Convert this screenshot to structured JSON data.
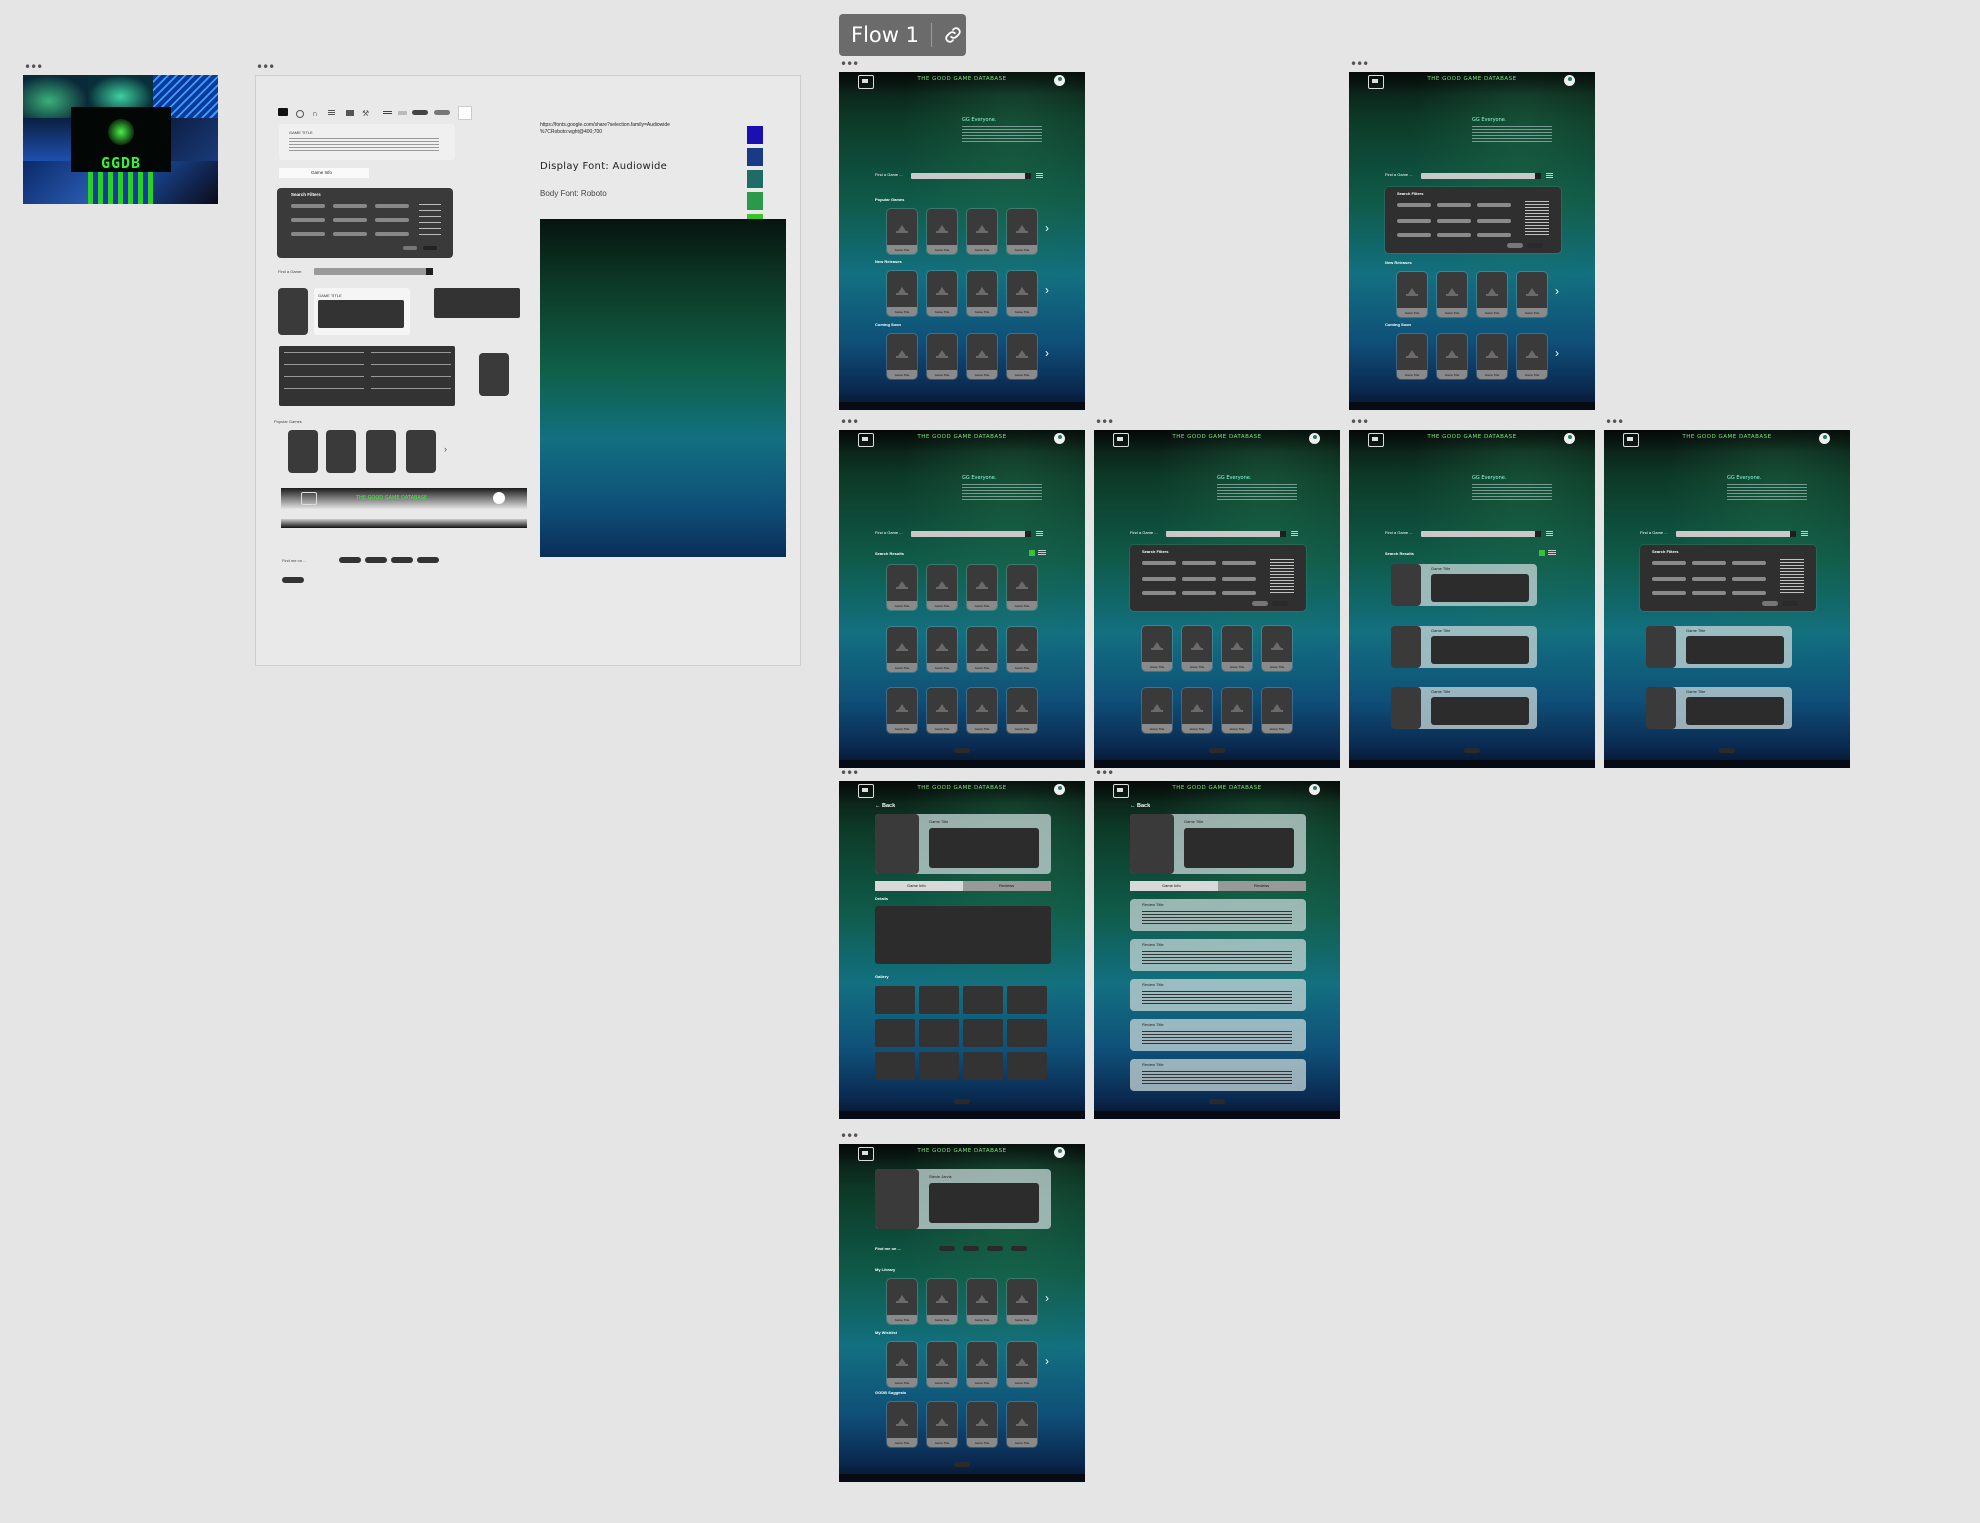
{
  "flow": {
    "label": "Flow 1"
  },
  "moodboard": {
    "logo_text": "GGDB"
  },
  "style_guide": {
    "url_line1": "https://fonts.google.com/share?selection.family=Audiowide",
    "url_line2": "%7CRoboto:wght@400;700",
    "display_font": "Display Font: Audiowide",
    "body_font": "Body Font: Roboto",
    "colors": [
      "#1a0fb0",
      "#1b3a86",
      "#1f6b66",
      "#2a9a4a",
      "#34c52e",
      "#47f21c"
    ],
    "game_info_label": "Game Info",
    "search_filters_label": "Search Filters",
    "find_a_game_label": "Find a Game:",
    "popular_games_label": "Popular Games",
    "game_title": "Game Title",
    "brand": "THE GOOD GAME DATABASE",
    "find_me_label": "Find me on ..."
  },
  "screen": {
    "brand": "THE GOOD GAME DATABASE",
    "welcome": "GG Everyone.",
    "find_label": "Find a Game ...",
    "popular": "Popular Games",
    "new_releases": "New Releases",
    "coming_soon": "Coming Soon",
    "search_results": "Search Results",
    "search_filters": "Search Filters",
    "game_title": "Game Title",
    "back": "← Back",
    "game_info_tab": "Game Info",
    "reviews_tab": "Reviews",
    "details": "Details",
    "gallery": "Gallery",
    "review_title": "Review Title",
    "user_name": "Stevie Jarvis",
    "find_me": "Find me on ...",
    "my_library": "My Library",
    "my_wishlist": "My Wishlist",
    "ggdb_suggests": "GGDB Suggests",
    "card_caption": "Game Title"
  }
}
